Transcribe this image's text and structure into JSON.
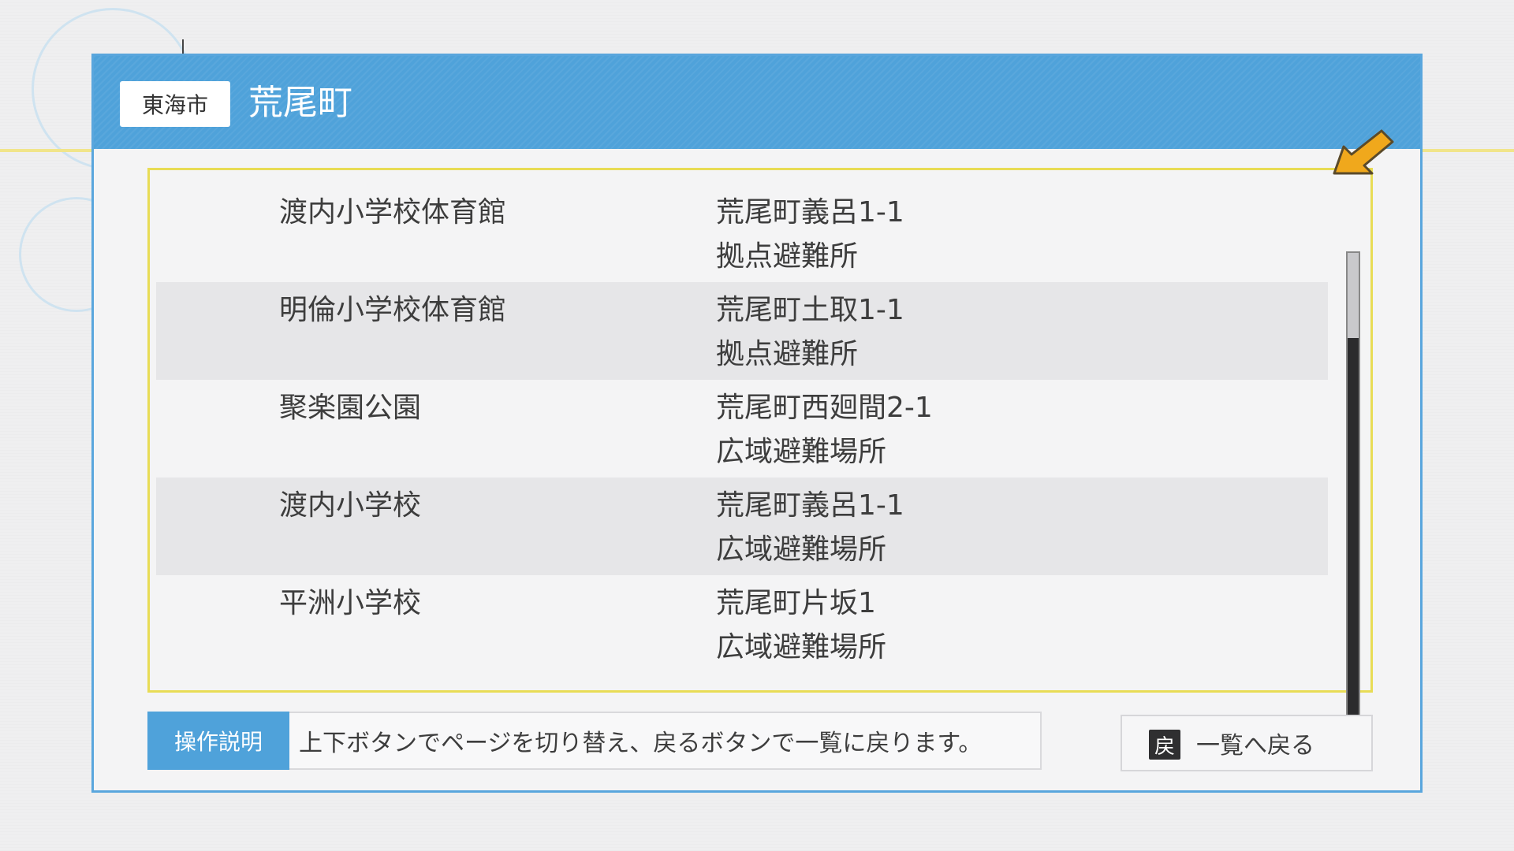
{
  "header": {
    "city": "東海市",
    "town": "荒尾町"
  },
  "shelters": [
    {
      "name": "渡内小学校体育館",
      "address": "荒尾町義呂1-1",
      "type": "拠点避難所"
    },
    {
      "name": "明倫小学校体育館",
      "address": "荒尾町土取1-1",
      "type": "拠点避難所"
    },
    {
      "name": "聚楽園公園",
      "address": "荒尾町西廻間2-1",
      "type": "広域避難場所"
    },
    {
      "name": "渡内小学校",
      "address": "荒尾町義呂1-1",
      "type": "広域避難場所"
    },
    {
      "name": "平洲小学校",
      "address": "荒尾町片坂1",
      "type": "広域避難場所"
    }
  ],
  "help": {
    "label": "操作説明",
    "text": "上下ボタンでページを切り替え、戻るボタンで一覧に戻ります。"
  },
  "back_button": {
    "key": "戻",
    "label": "一覧へ戻る"
  },
  "colors": {
    "accent_blue": "#4fa2da",
    "frame_yellow": "#e8dc55",
    "pointer_orange": "#f0a81c"
  },
  "icons": {
    "pointer": "pointer-arrow-icon"
  }
}
